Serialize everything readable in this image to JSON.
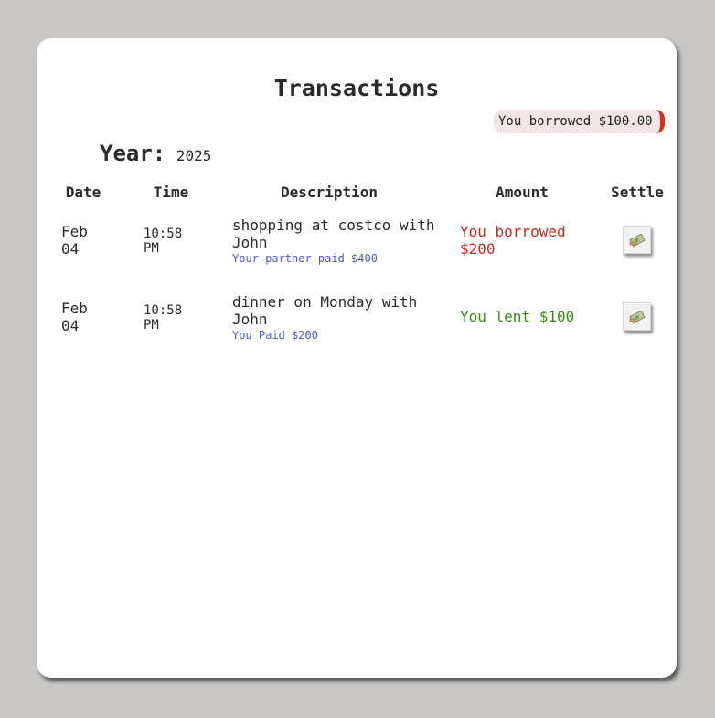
{
  "page": {
    "title": "Transactions",
    "balance_badge": "You borrowed $100.00",
    "year_label": "Year:",
    "year_value": "2025"
  },
  "table": {
    "headers": [
      "Date",
      "Time",
      "Description",
      "Amount",
      "Settle"
    ],
    "rows": [
      {
        "date_month": "Feb",
        "date_day": "04",
        "time_hm": "10:58",
        "time_ampm": "PM",
        "description": "shopping at costco with John",
        "sub_note": "Your partner paid $400",
        "amount_line1": "You borrowed",
        "amount_line2": "$200",
        "amount_type": "borrowed",
        "settle_icon": "money-icon"
      },
      {
        "date_month": "Feb",
        "date_day": "04",
        "time_hm": "10:58",
        "time_ampm": "PM",
        "description": "dinner on Monday with John",
        "sub_note": "You Paid $200",
        "amount_line1": "You lent $100",
        "amount_line2": "",
        "amount_type": "lent",
        "settle_icon": "money-icon"
      }
    ]
  },
  "colors": {
    "borrowed": "#cc2a1a",
    "lent": "#3a8a1e",
    "sub_note": "#4b5bd6",
    "badge_accent": "#d0341f"
  }
}
